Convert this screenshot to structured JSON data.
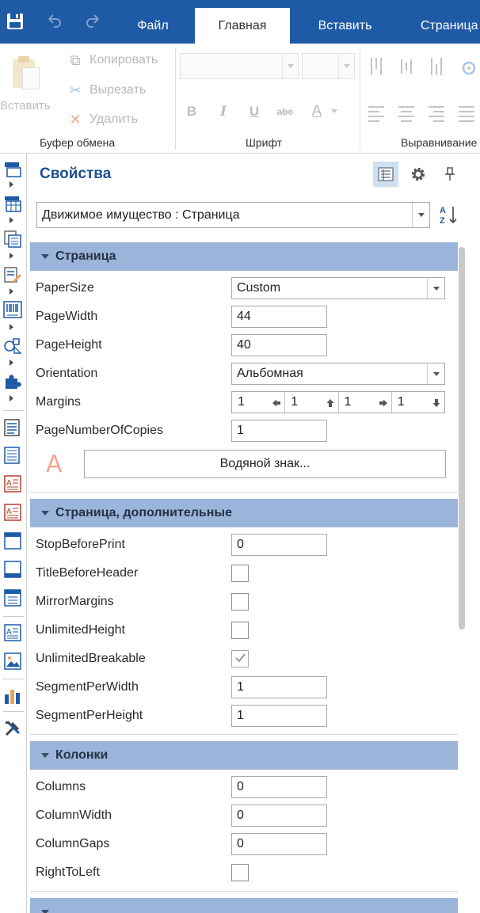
{
  "tabs": {
    "file": "Файл",
    "home": "Главная",
    "insert": "Вставить",
    "page": "Страница"
  },
  "ribbon": {
    "clipboard": {
      "paste": "Вставить",
      "copy": "Копировать",
      "cut": "Вырезать",
      "delete": "Удалить",
      "label": "Буфер обмена"
    },
    "font": {
      "label": "Шрифт",
      "bold": "B",
      "italic": "I",
      "underline": "U",
      "strike": "abc",
      "color": "A"
    },
    "alignment": {
      "label": "Выравнивание"
    }
  },
  "properties": {
    "title": "Свойства",
    "object": "Движимое имущество : Страница",
    "categories": {
      "page": "Страница",
      "page_extra": "Страница, дополнительные",
      "columns": "Колонки"
    },
    "page": {
      "papersize_label": "PaperSize",
      "papersize_value": "Custom",
      "pagewidth_label": "PageWidth",
      "pagewidth_value": "44",
      "pageheight_label": "PageHeight",
      "pageheight_value": "40",
      "orientation_label": "Orientation",
      "orientation_value": "Альбомная",
      "margins_label": "Margins",
      "margin_left": "1",
      "margin_top": "1",
      "margin_right": "1",
      "margin_bottom": "1",
      "copies_label": "PageNumberOfCopies",
      "copies_value": "1",
      "watermark_button": "Водяной знак...",
      "watermark_icon": "A"
    },
    "page_extra": {
      "stopbeforeprint_label": "StopBeforePrint",
      "stopbeforeprint_value": "0",
      "titlebeforeheader_label": "TitleBeforeHeader",
      "mirrormargins_label": "MirrorMargins",
      "unlimitedheight_label": "UnlimitedHeight",
      "unlimitedbreakable_label": "UnlimitedBreakable",
      "segmentperwidth_label": "SegmentPerWidth",
      "segmentperwidth_value": "1",
      "segmentperheight_label": "SegmentPerHeight",
      "segmentperheight_value": "1"
    },
    "columns": {
      "columns_label": "Columns",
      "columns_value": "0",
      "columnwidth_label": "ColumnWidth",
      "columnwidth_value": "0",
      "columngaps_label": "ColumnGaps",
      "columngaps_value": "0",
      "righttoleft_label": "RightToLeft"
    },
    "checkboxes": {
      "titlebeforeheader": false,
      "mirrormargins": false,
      "unlimitedheight": false,
      "unlimitedbreakable": true,
      "righttoleft": false
    }
  },
  "colors": {
    "accent": "#1e5aa6",
    "category": "#9bb4da",
    "title": "#1e4f8f"
  }
}
